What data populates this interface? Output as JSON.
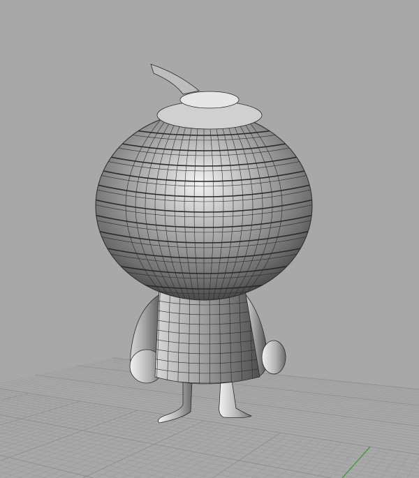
{
  "viewport": {
    "background": "#a8a8a8",
    "grid_color": "#9b9b9b",
    "grid_major_color": "#8f8f8f",
    "x_axis_color": "#b23a3a",
    "y_axis_color": "#3a9a3a",
    "model_fill": "#8a8a8a",
    "wire_color": "#2a2a2a"
  }
}
